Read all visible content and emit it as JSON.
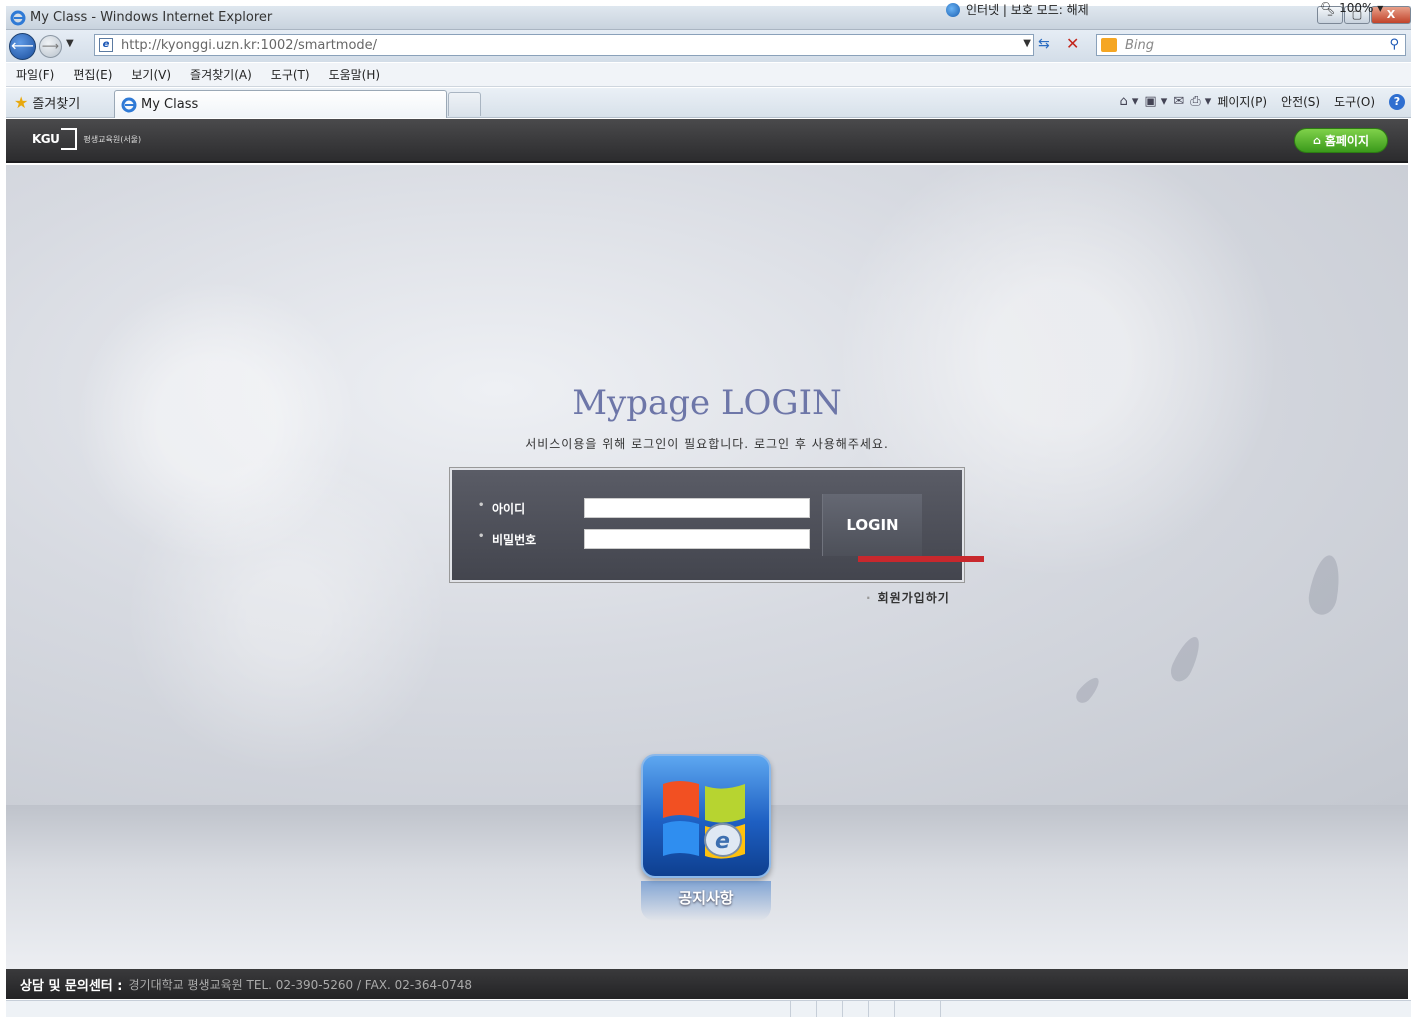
{
  "window": {
    "title": "My Class - Windows Internet Explorer",
    "controls": {
      "minimize": "–",
      "maximize": "▢",
      "close": "X"
    }
  },
  "address": {
    "url": "http://kyonggi.uzn.kr:1002/smartmode/",
    "search_placeholder": "Bing"
  },
  "menu": [
    "파일(F)",
    "편집(E)",
    "보기(V)",
    "즐겨찾기(A)",
    "도구(T)",
    "도움말(H)"
  ],
  "favorites_label": "즐겨찾기",
  "tab": {
    "label": "My Class"
  },
  "commands": {
    "page": "페이지(P)",
    "safety": "안전(S)",
    "tools": "도구(O)"
  },
  "site": {
    "logo_text": "KGU",
    "logo_sub": "평생교육원(서울)",
    "home_button": "홈페이지"
  },
  "login": {
    "title": "Mypage LOGIN",
    "subtitle": "서비스이용을 위해 로그인이 필요합니다. 로그인 후 사용해주세요.",
    "id_label": "아이디",
    "password_label": "비밀번호",
    "id_value": "",
    "password_value": "",
    "button": "LOGIN",
    "join_link": "회원가입하기"
  },
  "notice": {
    "label": "공지사항"
  },
  "footer": {
    "heading": "상담 및 문의센터 :",
    "info": "경기대학교 평생교육원 TEL. 02-390-5260 / FAX. 02-364-0748"
  },
  "status": {
    "zone": "인터넷 | 보호 모드: 해제",
    "zoom": "100%"
  },
  "colors": {
    "accent_title": "#6d76a8",
    "home_button": "#3a9a1b",
    "red_mark": "#c8282d"
  }
}
